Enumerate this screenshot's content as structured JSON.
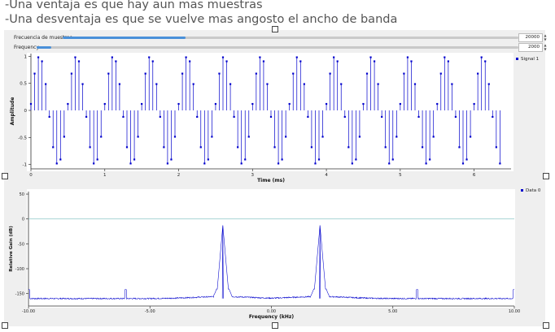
{
  "notes": [
    "-Una ventaja es que hay aun mas muestras",
    "-Una desventaja es que se vuelve mas angosto el ancho de banda"
  ],
  "controls": [
    {
      "label": "Frecuencia de muestreo",
      "value": "20000",
      "fraction": 0.27
    },
    {
      "label": "Frequency",
      "value": "2000",
      "fraction": 0.03
    }
  ],
  "chart_data": [
    {
      "type": "scatter",
      "style": "stem",
      "xlabel": "Time (ms)",
      "ylabel": "Amplitude",
      "xlim": [
        0,
        6.5
      ],
      "ylim": [
        -1.08,
        1.05
      ],
      "xticks": [
        "0",
        "1",
        "2",
        "3",
        "4",
        "5",
        "6"
      ],
      "yticks": [
        "1",
        "0.5",
        "0",
        "-0.5",
        "-1"
      ],
      "legend_position": "top-right",
      "grid": false,
      "series": [
        {
          "name": "Signal 1",
          "color": "#0000cc",
          "sample_rate_hz": 20000,
          "tone_hz": 2000,
          "phase_rad": 0.12,
          "n_samples": 128
        }
      ]
    },
    {
      "type": "line",
      "xlabel": "Frequency (kHz)",
      "ylabel": "Relative Gain (dB)",
      "xlim": [
        -10,
        10
      ],
      "ylim": [
        -175,
        55
      ],
      "xticks": [
        "-10.00",
        "-5.00",
        "0.00",
        "5.00",
        "10.00"
      ],
      "yticks": [
        "50",
        "0",
        "-50",
        "-100",
        "-150"
      ],
      "reference_line_db": 0,
      "legend_position": "top-right",
      "grid": false,
      "series": [
        {
          "name": "Data 0",
          "color": "#0000cc",
          "noise_floor_db": -160,
          "peaks": [
            {
              "x": -2.0,
              "y": -13
            },
            {
              "x": 2.0,
              "y": -13
            }
          ],
          "spurs": [
            {
              "x": -6.0,
              "y": -142
            },
            {
              "x": 6.0,
              "y": -142
            }
          ],
          "edge_level_db": -142
        }
      ]
    }
  ],
  "colors": {
    "accent": "#4a90d9",
    "trace": "#0000cc",
    "reference": "#9ccfcf"
  }
}
